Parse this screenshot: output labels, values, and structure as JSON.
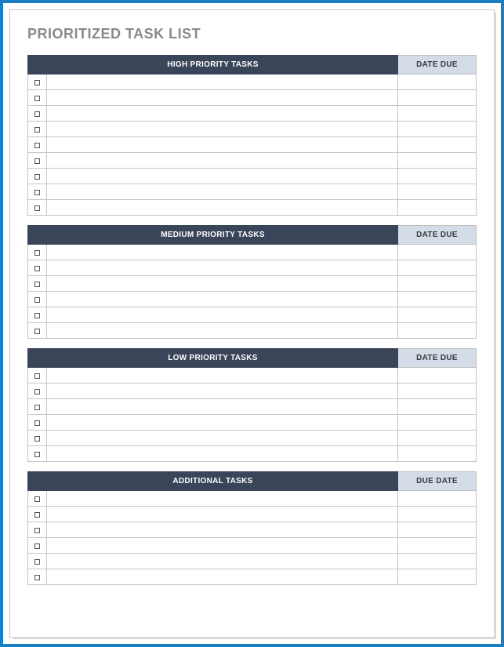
{
  "title": "PRIORITIZED TASK LIST",
  "sections": [
    {
      "task_header": "HIGH PRIORITY TASKS",
      "date_header": "DATE DUE",
      "rows": [
        {
          "done": false,
          "task": "",
          "date": ""
        },
        {
          "done": false,
          "task": "",
          "date": ""
        },
        {
          "done": false,
          "task": "",
          "date": ""
        },
        {
          "done": false,
          "task": "",
          "date": ""
        },
        {
          "done": false,
          "task": "",
          "date": ""
        },
        {
          "done": false,
          "task": "",
          "date": ""
        },
        {
          "done": false,
          "task": "",
          "date": ""
        },
        {
          "done": false,
          "task": "",
          "date": ""
        },
        {
          "done": false,
          "task": "",
          "date": ""
        }
      ]
    },
    {
      "task_header": "MEDIUM PRIORITY TASKS",
      "date_header": "DATE DUE",
      "rows": [
        {
          "done": false,
          "task": "",
          "date": ""
        },
        {
          "done": false,
          "task": "",
          "date": ""
        },
        {
          "done": false,
          "task": "",
          "date": ""
        },
        {
          "done": false,
          "task": "",
          "date": ""
        },
        {
          "done": false,
          "task": "",
          "date": ""
        },
        {
          "done": false,
          "task": "",
          "date": ""
        }
      ]
    },
    {
      "task_header": "LOW PRIORITY TASKS",
      "date_header": "DATE DUE",
      "rows": [
        {
          "done": false,
          "task": "",
          "date": ""
        },
        {
          "done": false,
          "task": "",
          "date": ""
        },
        {
          "done": false,
          "task": "",
          "date": ""
        },
        {
          "done": false,
          "task": "",
          "date": ""
        },
        {
          "done": false,
          "task": "",
          "date": ""
        },
        {
          "done": false,
          "task": "",
          "date": ""
        }
      ]
    },
    {
      "task_header": "ADDITIONAL TASKS",
      "date_header": "DUE DATE",
      "rows": [
        {
          "done": false,
          "task": "",
          "date": ""
        },
        {
          "done": false,
          "task": "",
          "date": ""
        },
        {
          "done": false,
          "task": "",
          "date": ""
        },
        {
          "done": false,
          "task": "",
          "date": ""
        },
        {
          "done": false,
          "task": "",
          "date": ""
        },
        {
          "done": false,
          "task": "",
          "date": ""
        }
      ]
    }
  ]
}
